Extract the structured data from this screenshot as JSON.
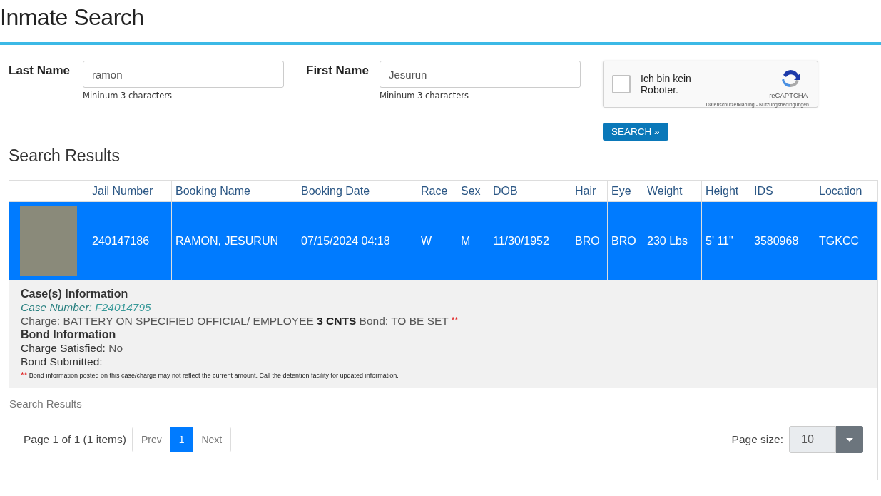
{
  "page": {
    "title": "Inmate Search"
  },
  "search_form": {
    "fields": [
      {
        "label": "Last Name",
        "value": "ramon",
        "hint": "Mininum 3 characters"
      },
      {
        "label": "First Name",
        "value": "Jesurun",
        "hint": "Mininum 3 characters"
      }
    ],
    "captcha": {
      "label": "Ich bin kein Roboter.",
      "checked": false,
      "brand": "reCAPTCHA",
      "links": "Datenschutzerklärung - Nutzungsbedingungen"
    },
    "button": "SEARCH »"
  },
  "results": {
    "heading": "Search Results",
    "columns": [
      "Jail Number",
      "Booking Name",
      "Booking Date",
      "Race",
      "Sex",
      "DOB",
      "Hair",
      "Eye",
      "Weight",
      "Height",
      "IDS",
      "Location"
    ],
    "rows": [
      {
        "selected": true,
        "cells": [
          "240147186",
          "RAMON, JESURUN",
          "07/15/2024 04:18",
          "W",
          "M",
          "11/30/1952",
          "BRO",
          "BRO",
          "230 Lbs",
          "5' 11\"",
          "3580968",
          "TGKCC"
        ],
        "details": [
          {
            "kind": "heading",
            "text": "Case(s) Information"
          },
          {
            "kind": "case",
            "label": "Case Number:",
            "value": "F24014795"
          },
          {
            "kind": "charge",
            "text": "Charge: BATTERY ON SPECIFIED OFFICIAL/ EMPLOYEE **3 CNTS** Bond: TO BE SET",
            "mark": "**"
          },
          {
            "kind": "heading",
            "text": "Bond Information"
          },
          {
            "kind": "field",
            "label": "Charge Satisfied:",
            "value": "No"
          },
          {
            "kind": "field",
            "label": "Bond Submitted:"
          },
          {
            "kind": "note",
            "mark": "**",
            "text": "Bond information posted on this case/charge may not reflect the current amount. Call the detention facility for updated information."
          }
        ]
      }
    ],
    "caption": "Search Results",
    "pager": {
      "summary": "Page 1 of 1 (1 items)",
      "prev": "Prev",
      "pages": [
        {
          "label": "1",
          "selected": true
        }
      ],
      "next": "Next",
      "size_label": "Page size:",
      "size_value": "10"
    }
  }
}
